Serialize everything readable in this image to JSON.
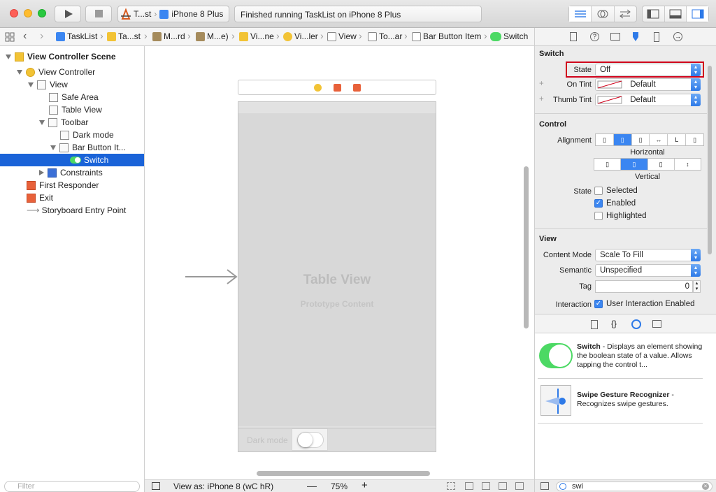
{
  "toolbar": {
    "scheme": "T...st",
    "device": "iPhone 8 Plus",
    "status": "Finished running TaskList on iPhone 8 Plus"
  },
  "breadcrumbs": [
    "TaskList",
    "Ta...st",
    "M...rd",
    "M...e)",
    "Vi...ne",
    "Vi...ler",
    "View",
    "To...ar",
    "Bar Button Item",
    "Switch"
  ],
  "navigator": {
    "items": [
      {
        "label": "View Controller Scene"
      },
      {
        "label": "View Controller"
      },
      {
        "label": "View"
      },
      {
        "label": "Safe Area"
      },
      {
        "label": "Table View"
      },
      {
        "label": "Toolbar"
      },
      {
        "label": "Dark mode"
      },
      {
        "label": "Bar Button It..."
      },
      {
        "label": "Switch"
      },
      {
        "label": "Constraints"
      },
      {
        "label": "First Responder"
      },
      {
        "label": "Exit"
      },
      {
        "label": "Storyboard Entry Point"
      }
    ],
    "filter_placeholder": "Filter"
  },
  "canvas": {
    "table_title": "Table View",
    "table_sub": "Prototype Content",
    "toolbar_label": "Dark mode",
    "view_as": "View as: iPhone 8 (wC hR)",
    "zoom": "75%"
  },
  "inspector": {
    "switch_section": "Switch",
    "state_label": "State",
    "state_value": "Off",
    "on_tint_label": "On Tint",
    "on_tint_value": "Default",
    "thumb_tint_label": "Thumb Tint",
    "thumb_tint_value": "Default",
    "control_section": "Control",
    "alignment_label": "Alignment",
    "horizontal": "Horizontal",
    "vertical": "Vertical",
    "state2_label": "State",
    "selected": "Selected",
    "enabled": "Enabled",
    "highlighted": "Highlighted",
    "view_section": "View",
    "content_mode_label": "Content Mode",
    "content_mode_value": "Scale To Fill",
    "semantic_label": "Semantic",
    "semantic_value": "Unspecified",
    "tag_label": "Tag",
    "tag_value": "0",
    "interaction_label": "Interaction",
    "interaction_value": "User Interaction Enabled"
  },
  "library": {
    "item1_title": "Switch",
    "item1_desc": " - Displays an element showing the boolean state of a value. Allows tapping the control t...",
    "item2_title": "Swipe Gesture Recognizer",
    "item2_desc": " - Recognizes swipe gestures.",
    "search_value": "swi"
  },
  "colors": {
    "accent": "#3b86f1",
    "selection": "#1a63d8",
    "switch_green": "#4cd964",
    "highlight_box": "#d0021b"
  }
}
